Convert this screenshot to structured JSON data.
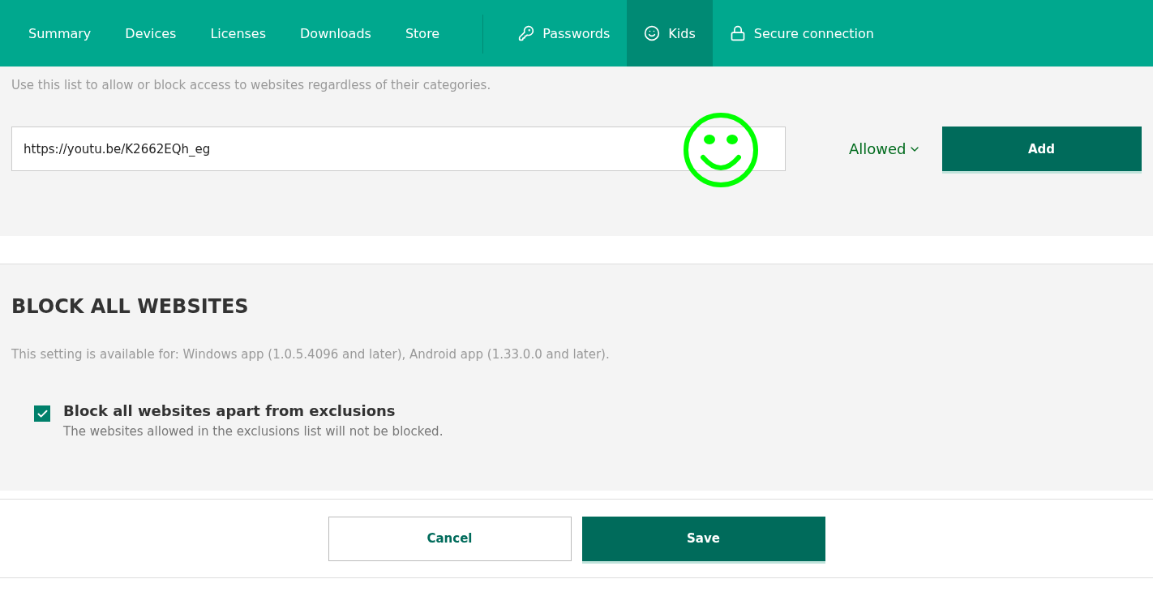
{
  "nav": {
    "items": [
      {
        "label": "Summary",
        "kind": "plain",
        "selected": false
      },
      {
        "label": "Devices",
        "kind": "plain",
        "selected": false
      },
      {
        "label": "Licenses",
        "kind": "plain",
        "selected": false
      },
      {
        "label": "Downloads",
        "kind": "plain",
        "selected": false
      },
      {
        "label": "Store",
        "kind": "plain",
        "selected": false
      },
      {
        "label": "Passwords",
        "kind": "key",
        "selected": false
      },
      {
        "label": "Kids",
        "kind": "kid",
        "selected": true
      },
      {
        "label": "Secure connection",
        "kind": "lock",
        "selected": false
      }
    ]
  },
  "exclusions": {
    "hint": "Use this list to allow or block access to websites regardless of their categories.",
    "url_value": "https://youtu.be/K2662EQh_eg",
    "access_dropdown": "Allowed",
    "add_button": "Add"
  },
  "block_all": {
    "heading": "BLOCK ALL WEBSITES",
    "availability": "This setting is available for: Windows app (1.0.5.4096 and later), Android app (1.33.0.0 and later).",
    "option": {
      "label": "Block all websites apart from exclusions",
      "description": "The websites allowed in the exclusions list will not be blocked.",
      "checked": true
    }
  },
  "footer": {
    "buttons": [
      {
        "label": "Cancel",
        "kind": "secondary"
      },
      {
        "label": "Save",
        "kind": "primary"
      }
    ]
  }
}
